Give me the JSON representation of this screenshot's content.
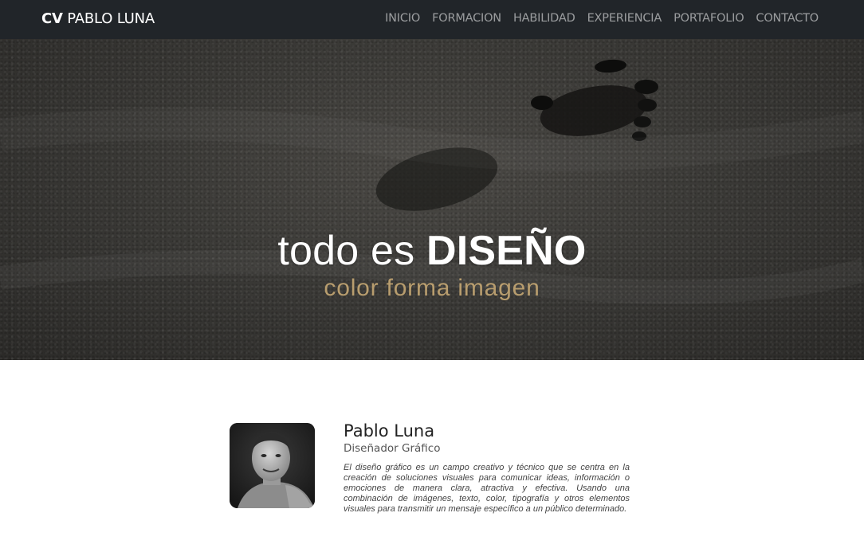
{
  "navbar": {
    "brand_strong": "CV",
    "brand_rest": " PABLO LUNA",
    "links": [
      "INICIO",
      "FORMACION",
      "HABILIDAD",
      "EXPERIENCIA",
      "PORTAFOLIO",
      "CONTACTO"
    ]
  },
  "hero": {
    "title_light": "todo es ",
    "title_bold": "DISEÑO",
    "subtitle": "color forma imagen",
    "subtitle_color": "#b89d6e"
  },
  "profile": {
    "name": "Pablo Luna",
    "role": "Diseñador Gráfico",
    "bio": "El diseño gráfico es un campo creativo y técnico que se centra en la creación de soluciones visuales para comunicar ideas, información o emociones de manera clara, atractiva y efectiva. Usando una combinación de imágenes, texto, color, tipografía y otros elementos visuales para transmitir un mensaje específico a un público determinado."
  },
  "colors": {
    "navbar_bg": "#212529",
    "nav_link": "rgba(255,255,255,0.55)"
  }
}
